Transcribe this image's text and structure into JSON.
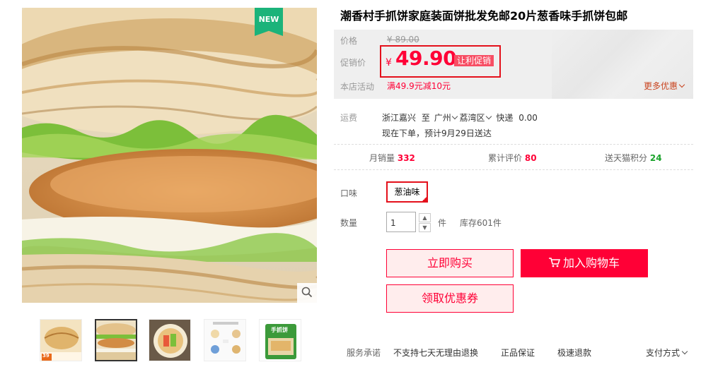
{
  "product": {
    "title": "潮香村手抓饼家庭装面饼批发免邮20片葱香味手抓饼包邮",
    "badge": "NEW"
  },
  "price": {
    "label": "价格",
    "original": "¥ 89.00",
    "promo_label": "促销价",
    "currency": "¥",
    "promo_value": "49.90",
    "promo_tag": "让利促销"
  },
  "activity": {
    "label": "本店活动",
    "text": "满49.9元减10元",
    "more": "更多优惠"
  },
  "shipping": {
    "label": "运费",
    "origin": "浙江嘉兴",
    "to": "至",
    "city": "广州",
    "district": "荔湾区",
    "method": "快递",
    "fee": "0.00",
    "delivery": "现在下单，预计9月29日送达"
  },
  "stats": {
    "monthly_sales_label": "月销量",
    "monthly_sales": "332",
    "reviews_label": "累计评价",
    "reviews": "80",
    "points_label": "送天猫积分",
    "points": "24"
  },
  "options": {
    "flavor_label": "口味",
    "flavor_selected": "葱油味",
    "qty_label": "数量",
    "qty_value": "1",
    "qty_unit": "件",
    "stock": "库存601件"
  },
  "buttons": {
    "buy_now": "立即购买",
    "add_cart": "加入购物车",
    "coupon": "领取优惠券"
  },
  "service": {
    "label": "服务承诺",
    "items": [
      "不支持七天无理由退换",
      "正品保证",
      "极速退款"
    ],
    "payment": "支付方式"
  },
  "thumbnail_captions": {
    "t1": "39",
    "t5": "手抓饼"
  },
  "colors": {
    "accent": "#ff0036",
    "badge_green": "#1bb37a",
    "points_green": "#1aa32b"
  }
}
